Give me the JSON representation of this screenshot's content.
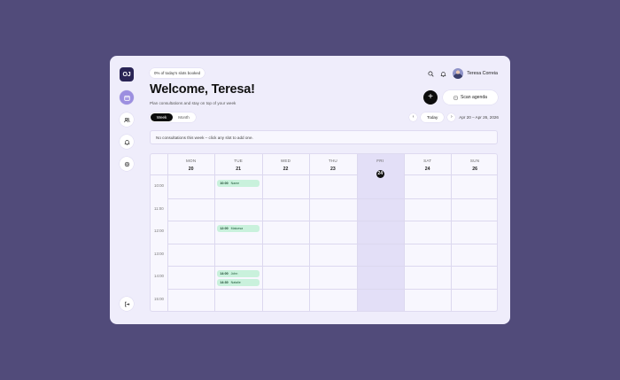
{
  "sidebar": {
    "logo_text": "OJ",
    "items": [
      {
        "icon": "calendar-icon",
        "active": true
      },
      {
        "icon": "users-icon",
        "active": false
      },
      {
        "icon": "bell-icon",
        "active": false
      },
      {
        "icon": "settings-icon",
        "active": false
      }
    ],
    "logout_icon": "logout-icon"
  },
  "header": {
    "booked_pill": "0% of today's slots booked",
    "welcome": "Welcome, Teresa!",
    "subtitle": "Plan consultations and stay on top of your week",
    "user_name": "Teresa Correia",
    "add_label": "+",
    "scan_label": "Scan agenda"
  },
  "view_toggle": {
    "week": "Week",
    "month": "Month",
    "selected": "Week"
  },
  "date_nav": {
    "prev": "‹",
    "today": "Today",
    "next": "›",
    "range": "Apr 20 – Apr 26, 2026"
  },
  "notice": "No consultations this week – click any slot to add one.",
  "calendar": {
    "days": [
      {
        "name": "MON",
        "num": "20"
      },
      {
        "name": "TUE",
        "num": "21"
      },
      {
        "name": "WED",
        "num": "22"
      },
      {
        "name": "THU",
        "num": "23"
      },
      {
        "name": "FRI",
        "num": "24",
        "today": true
      },
      {
        "name": "SAT",
        "num": "24"
      },
      {
        "name": "SUN",
        "num": "26"
      }
    ],
    "times": [
      "10:00",
      "11:00",
      "12:00",
      "13:00",
      "14:00",
      "15:00"
    ],
    "events": [
      {
        "day": 1,
        "time": "10:00",
        "label": "Name",
        "offset": 0
      },
      {
        "day": 1,
        "time": "12:00",
        "label": "Maluesa",
        "offset": 0
      },
      {
        "day": 1,
        "time": "14:00",
        "label": "John",
        "offset": 0
      },
      {
        "day": 1,
        "time": "14:30",
        "label": "Natalie",
        "offset": 0.5
      }
    ]
  },
  "colors": {
    "accent": "#9c8fe0",
    "event_bg": "#c9f1dc",
    "background": "#514b7a"
  }
}
